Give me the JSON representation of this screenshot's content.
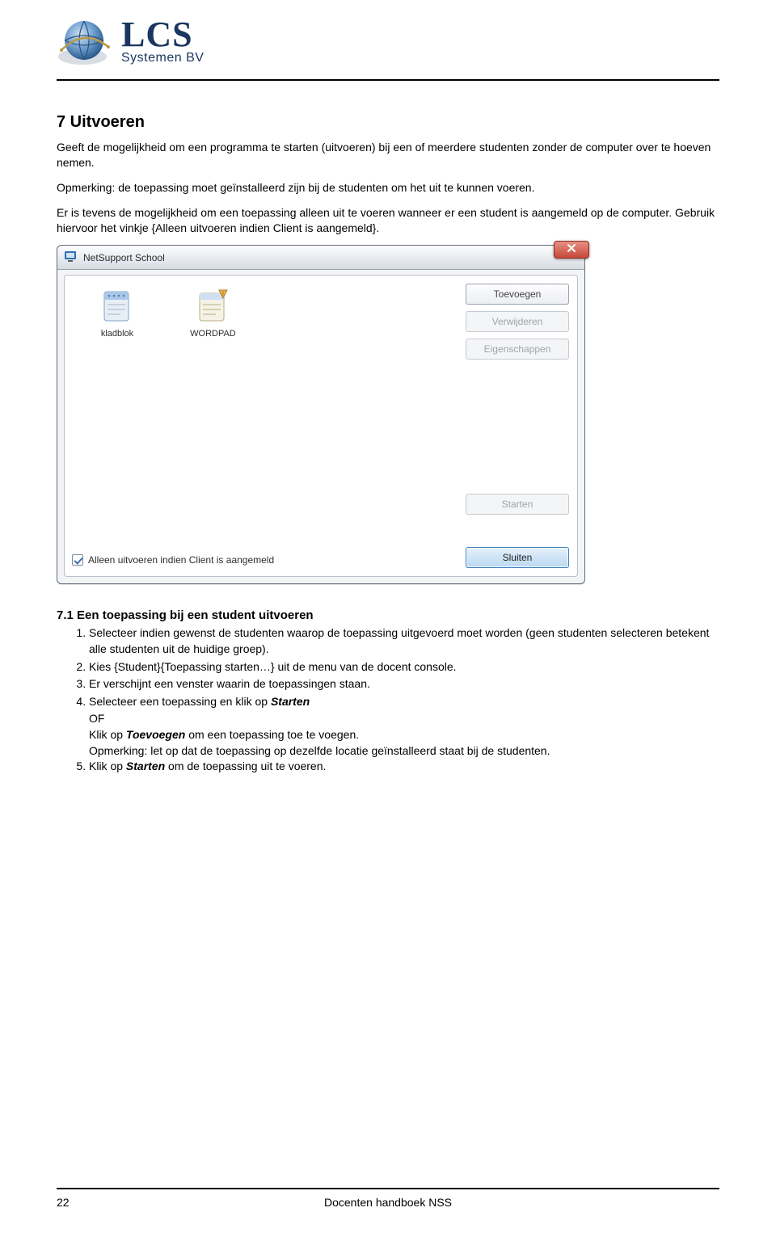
{
  "header": {
    "logo_main": "LCS",
    "logo_sub": "Systemen BV"
  },
  "section7": {
    "num_title": "7   Uitvoeren",
    "para1": "Geeft de mogelijkheid om een programma te starten (uitvoeren) bij een of meerdere studenten zonder de computer over te hoeven nemen.",
    "para2": "Opmerking: de toepassing moet geïnstalleerd zijn bij de studenten om het uit te kunnen voeren.",
    "para3": "Er is tevens de mogelijkheid om een toepassing alleen uit te voeren wanneer er een student is aangemeld op de computer. Gebruik hiervoor het vinkje {Alleen uitvoeren indien Client is aangemeld}."
  },
  "window": {
    "title": "NetSupport School",
    "items": [
      "kladblok",
      "WORDPAD"
    ],
    "buttons": {
      "toevoegen": "Toevoegen",
      "verwijderen": "Verwijderen",
      "eigenschappen": "Eigenschappen",
      "starten": "Starten",
      "sluiten": "Sluiten"
    },
    "checkbox_label": "Alleen uitvoeren indien Client is aangemeld"
  },
  "section71": {
    "num_title": "7.1   Een toepassing bij een student uitvoeren",
    "li1": "Selecteer indien gewenst de studenten waarop de toepassing uitgevoerd moet worden (geen studenten selecteren betekent alle studenten uit de huidige groep).",
    "li2": "Kies {Student}{Toepassing starten…} uit de menu van de docent console.",
    "li3": "Er verschijnt een venster waarin de toepassingen staan.",
    "li4_pre": "Selecteer een toepassing en klik op ",
    "li4_bold": "Starten",
    "li4_of": "OF",
    "li4_b_pre": "Klik op ",
    "li4_b_bold": "Toevoegen",
    "li4_b_post": " om een toepassing toe te voegen.",
    "li4_note": "Opmerking: let op dat de toepassing op dezelfde locatie geïnstalleerd staat bij de studenten.",
    "li5_pre": "Klik op ",
    "li5_bold": "Starten",
    "li5_post": " om de toepassing uit te voeren."
  },
  "footer": {
    "page_number": "22",
    "doc_title": "Docenten handboek NSS"
  }
}
